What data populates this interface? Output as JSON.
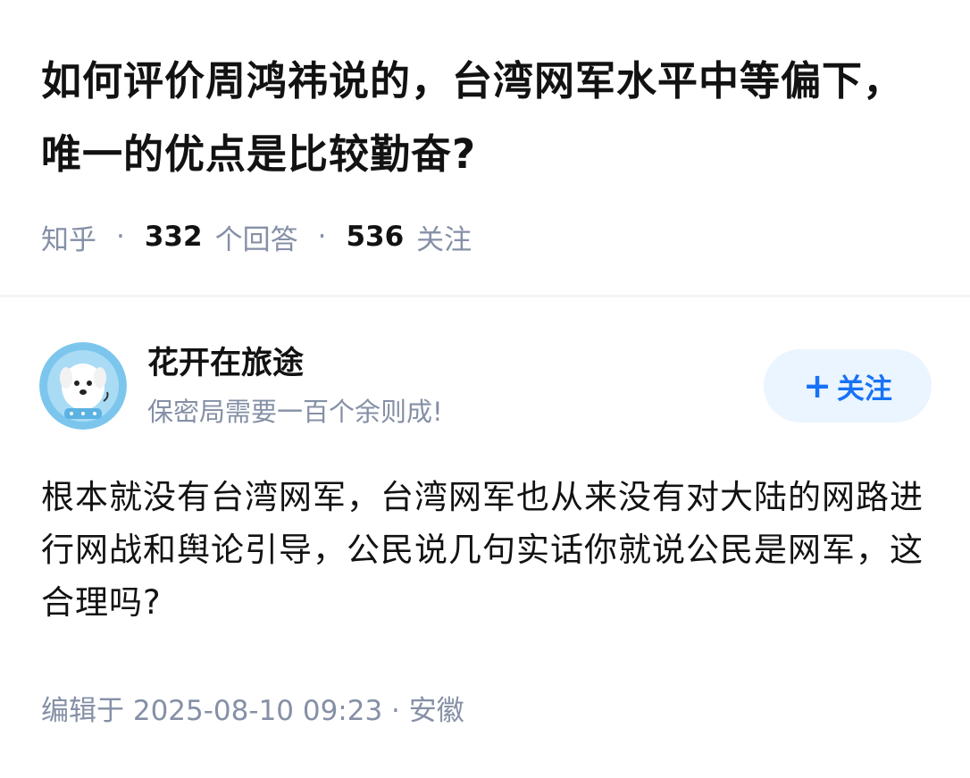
{
  "question": {
    "title": "如何评价周鸿祎说的，台湾网军水平中等偏下，唯一的优点是比较勤奋?",
    "source": "知乎",
    "separator": "·",
    "answer_count": "332",
    "answer_count_label": "个回答",
    "follow_count": "536",
    "follow_count_label": "关注"
  },
  "answer": {
    "author": {
      "name": "花开在旅途",
      "bio": "保密局需要一百个余则成!",
      "avatar_icon": "dog-astronaut-avatar-icon"
    },
    "follow_button": {
      "plus": "+",
      "label": "关注"
    },
    "content": "根本就没有台湾网军，台湾网军也从来没有对大陆的网路进行网战和舆论引导，公民说几句实话你就说公民是网军，这合理吗?",
    "footer": "编辑于 2025-08-10 09:23 · 安徽"
  },
  "colors": {
    "accent": "#1772f6",
    "follow_bg": "#ebf5ff",
    "muted_text": "#8590a6",
    "primary_text": "#121212"
  }
}
